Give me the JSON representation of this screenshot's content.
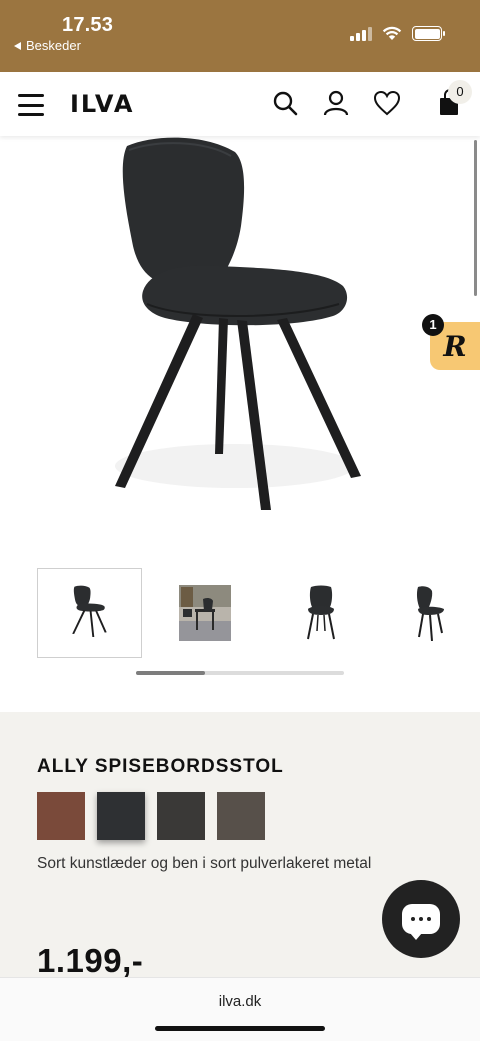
{
  "status_bar": {
    "time": "17.53",
    "back_label": "Beskeder",
    "background": "#9b7540"
  },
  "header": {
    "logo_text": "ILVA",
    "cart_count": "0",
    "icons": [
      "menu-icon",
      "search-icon",
      "user-icon",
      "heart-icon",
      "shopping-bag-icon"
    ]
  },
  "gallery": {
    "thumbnails": [
      {
        "name": "chair-front-view",
        "active": true
      },
      {
        "name": "chair-room-view",
        "active": false
      },
      {
        "name": "chair-front-view-2",
        "active": false
      },
      {
        "name": "chair-side-view",
        "active": false
      }
    ],
    "scroll_progress": 0.33
  },
  "review_badge": {
    "count": "1",
    "letter": "R",
    "color": "#f7c873"
  },
  "product": {
    "brand": "ALLY",
    "name": "SPISEBORDSSTOL",
    "swatches": [
      {
        "name": "brown",
        "color": "#7a4a3a",
        "selected": false
      },
      {
        "name": "black",
        "color": "#2e3033",
        "selected": true
      },
      {
        "name": "dark-grey",
        "color": "#3a3937",
        "selected": false
      },
      {
        "name": "taupe",
        "color": "#57504a",
        "selected": false
      }
    ],
    "variant_description": "Sort kunstlæder og ben i sort pulverlakeret metal",
    "price": "1.199,-"
  },
  "browser": {
    "url": "ilva.dk"
  }
}
